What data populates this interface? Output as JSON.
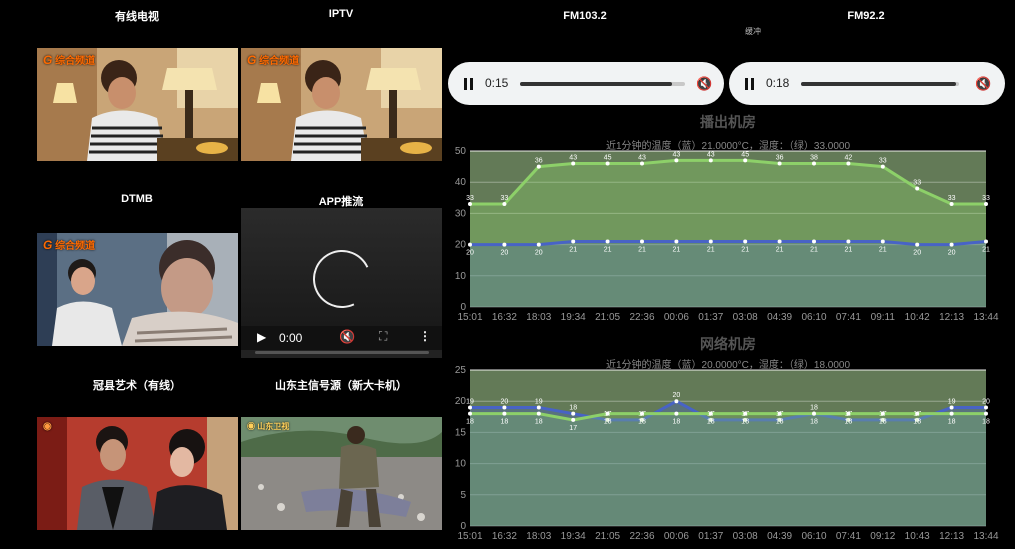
{
  "videos": {
    "tiles": [
      {
        "label": "有线电视",
        "logo": "综合频道"
      },
      {
        "label": "IPTV",
        "logo": "综合频道"
      },
      {
        "label": "DTMB",
        "logo": "综合频道"
      },
      {
        "label": "APP推流"
      },
      {
        "label": "冠县艺术（有线）"
      },
      {
        "label": "山东主信号源（新大卡机）"
      }
    ],
    "player": {
      "time": "0:00",
      "play_icon": "play-icon",
      "mute_icon": "muted-icon",
      "fullscreen_icon": "fullscreen-icon",
      "menu_icon": "more-vert-icon"
    }
  },
  "radio": {
    "buffering_text": "缓冲",
    "streams": [
      {
        "label": "FM103.2",
        "time": "0:15",
        "progress": 0.92
      },
      {
        "label": "FM92.2",
        "time": "0:18",
        "progress": 0.98
      }
    ]
  },
  "colors": {
    "green_line": "#8dd069",
    "green_fill": "#4e6b3d",
    "blue_line": "#4863c6",
    "bg_fill": "#637a57"
  },
  "chart_data": [
    {
      "type": "area",
      "title": "播出机房",
      "subtitle": "近1分钟的温度（蓝）21.0000°C，湿度：（绿）33.0000",
      "x": [
        "15:01",
        "16:32",
        "18:03",
        "19:34",
        "21:05",
        "22:36",
        "00:06",
        "01:37",
        "03:08",
        "04:39",
        "06:10",
        "07:41",
        "09:11",
        "10:42",
        "12:13",
        "13:44"
      ],
      "ylim": [
        0,
        50
      ],
      "yticks": [
        0,
        10,
        20,
        30,
        40,
        50
      ],
      "series": [
        {
          "color": "#8dd069",
          "values": [
            33,
            33,
            45,
            46,
            46,
            46,
            47,
            47,
            47,
            46,
            46,
            46,
            45,
            38,
            33,
            33
          ],
          "labels": [
            "33",
            "33",
            "36",
            "43",
            "45",
            "43",
            "43",
            "43",
            "45",
            "36",
            "38",
            "42",
            "33",
            "33",
            "33",
            "33"
          ]
        },
        {
          "color": "#4863c6",
          "values": [
            20,
            20,
            20,
            21,
            21,
            21,
            21,
            21,
            21,
            21,
            21,
            21,
            21,
            20,
            20,
            21
          ],
          "labels": [
            "20",
            "20",
            "20",
            "21",
            "21",
            "21",
            "21",
            "21",
            "21",
            "21",
            "21",
            "21",
            "21",
            "20",
            "20",
            "21"
          ]
        }
      ]
    },
    {
      "type": "area",
      "title": "网络机房",
      "subtitle": "近1分钟的温度（蓝）20.0000°C，湿度：（绿）18.0000",
      "x": [
        "15:01",
        "16:32",
        "18:03",
        "19:34",
        "21:05",
        "22:36",
        "00:06",
        "01:37",
        "03:08",
        "04:39",
        "06:10",
        "07:41",
        "09:12",
        "10:43",
        "12:13",
        "13:44"
      ],
      "ylim": [
        0,
        25
      ],
      "yticks": [
        0,
        5,
        10,
        15,
        20,
        25
      ],
      "series": [
        {
          "color": "#4863c6",
          "values": [
            19,
            19,
            19,
            18,
            17,
            17,
            20,
            17,
            17,
            17,
            18,
            17,
            17,
            17,
            19,
            19
          ],
          "labels": [
            "19",
            "20",
            "19",
            "18",
            "17",
            "17",
            "20",
            "17",
            "17",
            "17",
            "18",
            "17",
            "17",
            "17",
            "19",
            "20"
          ]
        },
        {
          "color": "#8dd069",
          "values": [
            18,
            18,
            18,
            17,
            18,
            18,
            18,
            18,
            18,
            18,
            18,
            18,
            18,
            18,
            18,
            18
          ],
          "labels": [
            "18",
            "18",
            "18",
            "17",
            "18",
            "18",
            "18",
            "18",
            "18",
            "18",
            "18",
            "18",
            "18",
            "18",
            "18",
            "18"
          ]
        }
      ]
    }
  ]
}
